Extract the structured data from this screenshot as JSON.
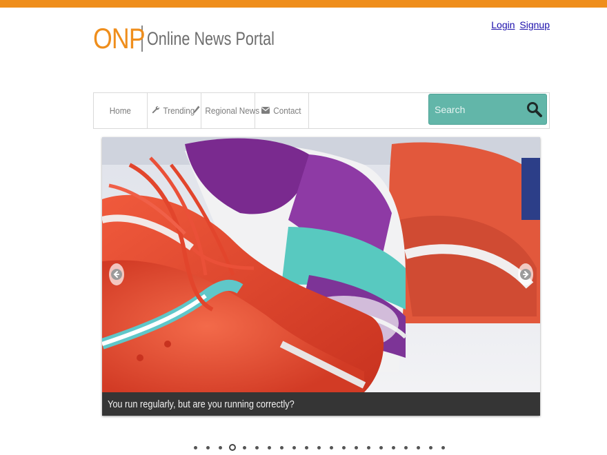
{
  "brand": {
    "abbr": "ONP",
    "name": "Online News Portal",
    "accent_color": "#ef8e1c"
  },
  "auth": {
    "login": "Login",
    "signup": "Signup"
  },
  "nav": {
    "items": [
      {
        "label": "Home",
        "icon": ""
      },
      {
        "label": "Trending",
        "icon": "wrench-icon"
      },
      {
        "label": "Regional News",
        "icon": "pencil-icon"
      },
      {
        "label": "Contact",
        "icon": "envelope-icon"
      }
    ]
  },
  "search": {
    "placeholder": "Search",
    "color": "#62b6a9"
  },
  "slider": {
    "caption": "You run regularly, but are you running correctly?",
    "image": "red and purple running shoes",
    "total_slides": 21,
    "active_slide": 4
  }
}
